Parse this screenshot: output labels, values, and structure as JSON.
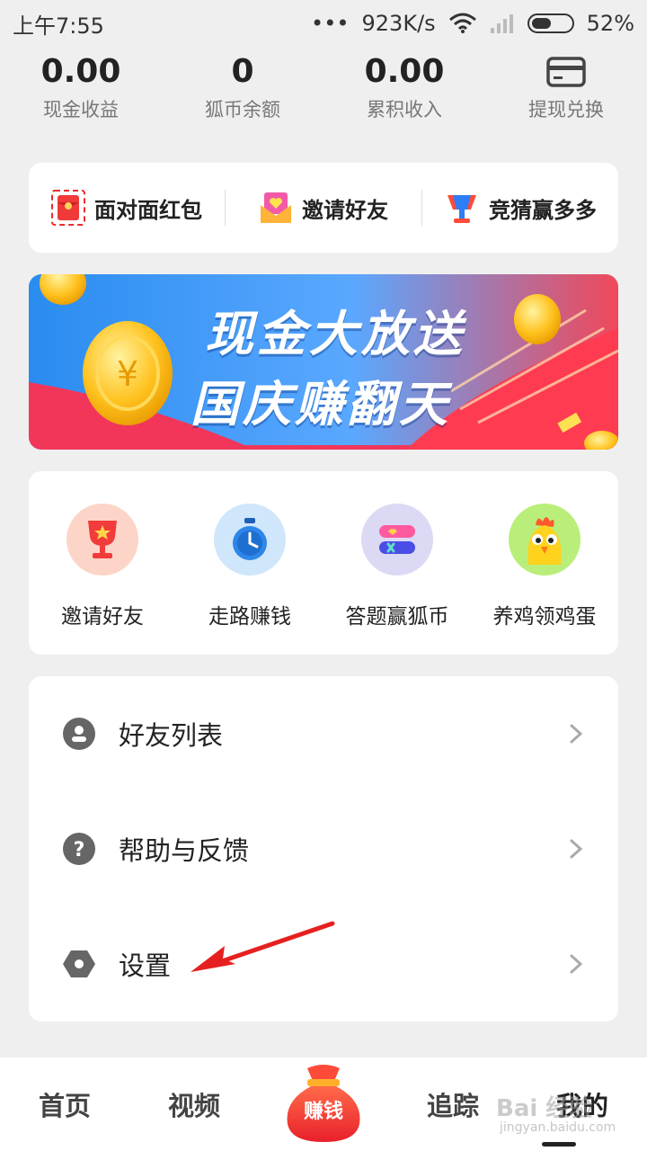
{
  "status_bar": {
    "time": "上午7:55",
    "dots": "•••",
    "net_speed": "923K/s",
    "battery": "52%",
    "battery_level": 0.52
  },
  "stats": [
    {
      "value": "0.00",
      "label": "现金收益"
    },
    {
      "value": "0",
      "label": "狐币余额"
    },
    {
      "value": "0.00",
      "label": "累积收入"
    },
    {
      "value": "",
      "label": "提现兑换",
      "icon": "card-icon"
    }
  ],
  "shortcuts": [
    {
      "label": "面对面红包",
      "icon": "red-envelope-icon"
    },
    {
      "label": "邀请好友",
      "icon": "invite-envelope-icon"
    },
    {
      "label": "竞猜赢多多",
      "icon": "trophy-icon"
    }
  ],
  "banner": {
    "line1": "现金大放送",
    "line2": "国庆赚翻天"
  },
  "features": [
    {
      "label": "邀请好友",
      "icon": "trophy-cup-icon",
      "color": "#fdd5c8"
    },
    {
      "label": "走路赚钱",
      "icon": "stopwatch-icon",
      "color": "#cfe6fb"
    },
    {
      "label": "答题赢狐币",
      "icon": "quiz-icon",
      "color": "#dcd9f5"
    },
    {
      "label": "养鸡领鸡蛋",
      "icon": "chicken-icon",
      "color": "#b9ee7a"
    }
  ],
  "menu": [
    {
      "label": "好友列表",
      "icon": "user-icon"
    },
    {
      "label": "帮助与反馈",
      "icon": "help-icon"
    },
    {
      "label": "设置",
      "icon": "settings-icon"
    }
  ],
  "tabbar": {
    "home": "首页",
    "video": "视频",
    "earn": "赚钱",
    "track": "追踪",
    "mine": "我的"
  },
  "watermark": {
    "text": "Bai 经验",
    "sub": "jingyan.baidu.com"
  },
  "colors": {
    "accent_red": "#f23b3b",
    "icon_gray": "#666666",
    "annotation_arrow": "#e62020"
  }
}
